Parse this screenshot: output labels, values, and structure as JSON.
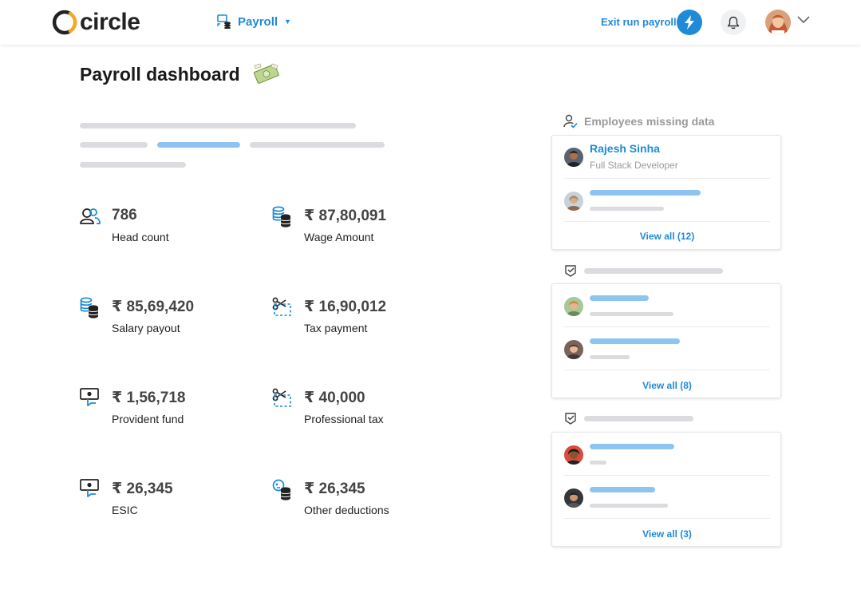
{
  "app": {
    "logo_text": "circle"
  },
  "header": {
    "module_label": "Payroll",
    "exit_label": "Exit run payroll"
  },
  "page": {
    "title": "Payroll dashboard"
  },
  "metrics": [
    {
      "value": "786",
      "label": "Head count",
      "icon": "people-icon"
    },
    {
      "value": "₹ 87,80,091",
      "label": "Wage Amount",
      "icon": "coins-icon"
    },
    {
      "value": "₹ 85,69,420",
      "label": "Salary payout",
      "icon": "coins-icon"
    },
    {
      "value": "₹ 16,90,012",
      "label": "Tax payment",
      "icon": "scissors-icon"
    },
    {
      "value": "₹ 1,56,718",
      "label": "Provident fund",
      "icon": "fund-icon"
    },
    {
      "value": "₹ 40,000",
      "label": "Professional tax",
      "icon": "scissors-icon"
    },
    {
      "value": "₹ 26,345",
      "label": "ESIC",
      "icon": "fund-icon"
    },
    {
      "value": "₹ 26,345",
      "label": "Other deductions",
      "icon": "deduction-icon"
    }
  ],
  "sidebar": {
    "missing_data": {
      "title": "Employees missing data",
      "employee": {
        "name": "Rajesh Sinha",
        "role": "Full Stack Developer"
      },
      "view_all": "View all (12)"
    },
    "section2": {
      "view_all": "View all (8)"
    },
    "section3": {
      "view_all": "View all (3)"
    }
  },
  "colors": {
    "accent": "#1f8ad6",
    "skeleton": "#dadce0",
    "skeleton_blue": "#8ec5f0"
  }
}
